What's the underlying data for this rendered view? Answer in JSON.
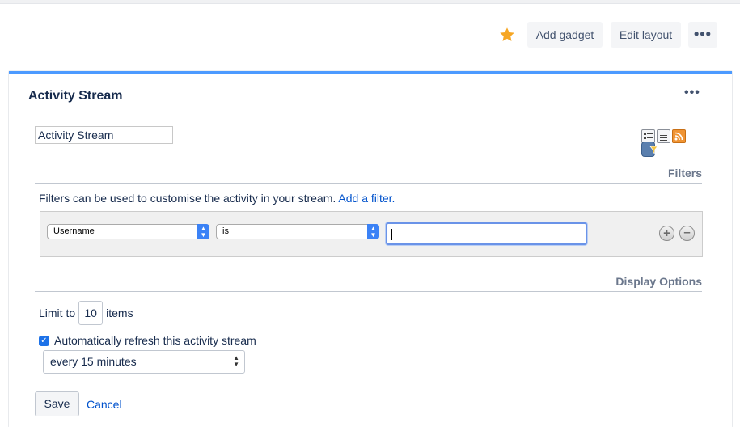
{
  "toolbar": {
    "add_gadget": "Add gadget",
    "edit_layout": "Edit layout",
    "more": "•••",
    "star_color": "#f6a623"
  },
  "gadget": {
    "header_title": "Activity Stream",
    "more": "•••",
    "title_input_value": "Activity Stream",
    "view_icons": [
      "list-view-icon",
      "full-view-icon",
      "filter-view-icon",
      "rss-icon"
    ],
    "accent_color": "#4c9aff"
  },
  "filters": {
    "heading": "Filters",
    "description": "Filters can be used to customise the activity in your stream.",
    "add_filter_link": "Add a filter.",
    "field_selected": "Username",
    "operator_selected": "is",
    "value": ""
  },
  "display": {
    "heading": "Display Options",
    "limit_label": "Limit to",
    "limit_value": "10",
    "limit_suffix": "items",
    "refresh_label": "Automatically refresh this activity stream",
    "refresh_checked": true,
    "interval_selected": "every 15 minutes"
  },
  "actions": {
    "save": "Save",
    "cancel": "Cancel"
  }
}
